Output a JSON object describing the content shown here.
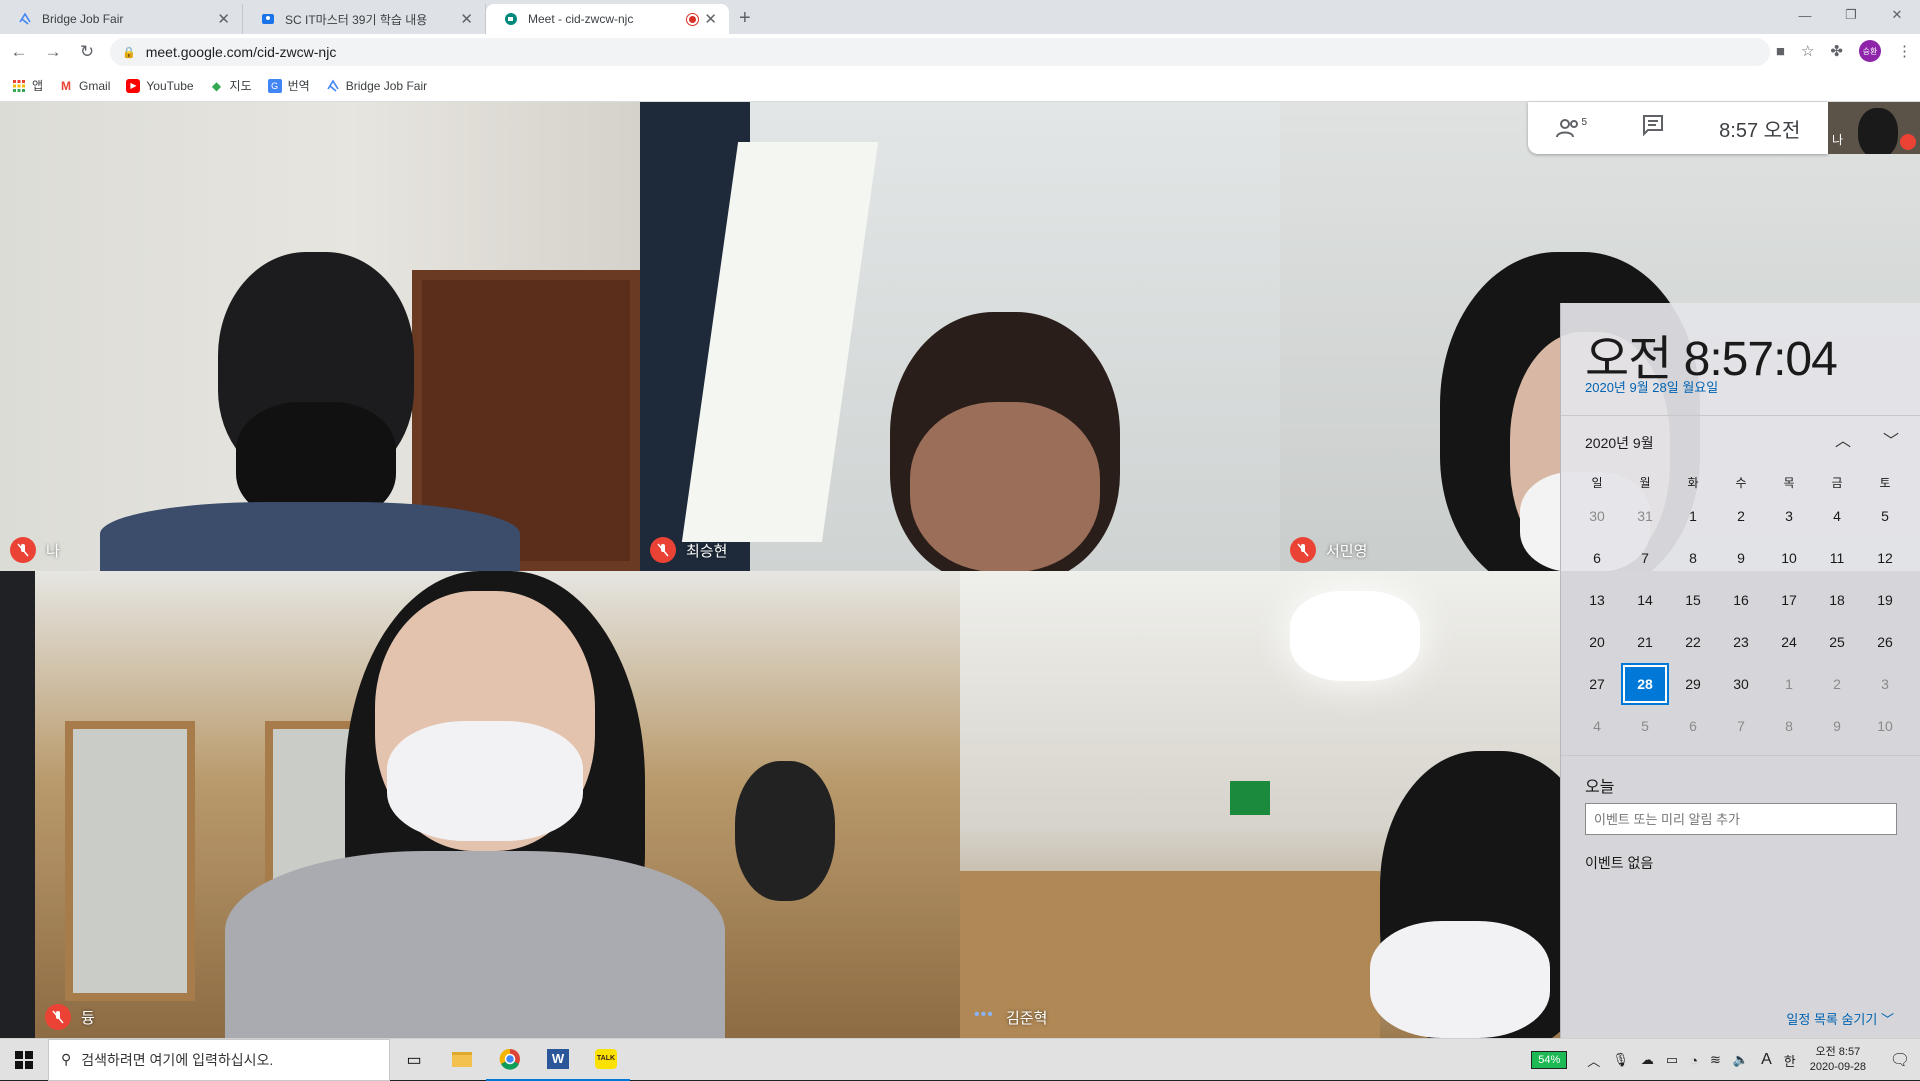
{
  "browser": {
    "tabs": [
      {
        "title": "Bridge Job Fair",
        "active": false
      },
      {
        "title": "SC IT마스터 39기 학습 내용",
        "active": false
      },
      {
        "title": "Meet - cid-zwcw-njc",
        "active": true
      }
    ],
    "url": "meet.google.com/cid-zwcw-njc",
    "profile_initials": "승환",
    "bookmarks": [
      "앱",
      "Gmail",
      "YouTube",
      "지도",
      "번역",
      "Bridge Job Fair"
    ]
  },
  "meet": {
    "participants_count": "5",
    "time": "8:57 오전",
    "self_label": "나",
    "participants": [
      {
        "name": "나",
        "muted": true
      },
      {
        "name": "최승현",
        "muted": true
      },
      {
        "name": "서민영",
        "muted": true
      },
      {
        "name": "듕",
        "muted": true
      },
      {
        "name": "김준혁",
        "muted": false
      }
    ]
  },
  "calendar": {
    "big_time": "오전 8:57:04",
    "full_date": "2020년 9월 28일 월요일",
    "month_label": "2020년 9월",
    "weekdays": [
      "일",
      "월",
      "화",
      "수",
      "목",
      "금",
      "토"
    ],
    "weeks": [
      [
        "30",
        "31",
        "1",
        "2",
        "3",
        "4",
        "5"
      ],
      [
        "6",
        "7",
        "8",
        "9",
        "10",
        "11",
        "12"
      ],
      [
        "13",
        "14",
        "15",
        "16",
        "17",
        "18",
        "19"
      ],
      [
        "20",
        "21",
        "22",
        "23",
        "24",
        "25",
        "26"
      ],
      [
        "27",
        "28",
        "29",
        "30",
        "1",
        "2",
        "3"
      ],
      [
        "4",
        "5",
        "6",
        "7",
        "8",
        "9",
        "10"
      ]
    ],
    "selected_day": "28",
    "today_label": "오늘",
    "event_placeholder": "이벤트 또는 미리 알림 추가",
    "no_events": "이벤트 없음",
    "hide_schedule": "일정 목록 숨기기"
  },
  "taskbar": {
    "search_placeholder": "검색하려면 여기에 입력하십시오.",
    "battery": "54%",
    "ime": "한",
    "font_indicator": "A",
    "clock_time": "오전 8:57",
    "clock_date": "2020-09-28"
  }
}
